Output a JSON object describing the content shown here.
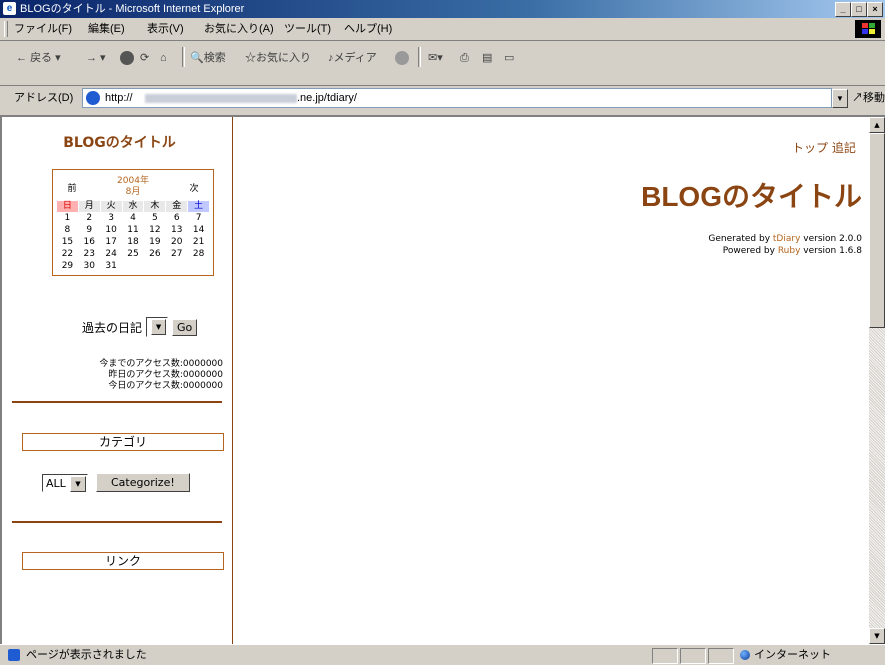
{
  "window": {
    "title": "BLOGのタイトル - Microsoft Internet Explorer",
    "controls": [
      "_",
      "□",
      "×"
    ]
  },
  "menu": [
    "ファイル(F)",
    "編集(E)",
    "表示(V)",
    "お気に入り(A)",
    "ツール(T)",
    "ヘルプ(H)"
  ],
  "toolbar": {
    "back": "戻る",
    "search": "検索",
    "favorites": "お気に入り",
    "media": "メディア"
  },
  "address": {
    "label": "アドレス(D)",
    "url_prefix": "http://",
    "url_suffix": ".ne.jp/tdiary/",
    "go": "移動"
  },
  "sidebar": {
    "title": "BLOGのタイトル",
    "calendar": {
      "prev": "前",
      "next": "次",
      "year": "2004年",
      "month": "8月",
      "weekdays": [
        "日",
        "月",
        "火",
        "水",
        "木",
        "金",
        "土"
      ],
      "days": [
        "1",
        "2",
        "3",
        "4",
        "5",
        "6",
        "7",
        "8",
        "9",
        "10",
        "11",
        "12",
        "13",
        "14",
        "15",
        "16",
        "17",
        "18",
        "19",
        "20",
        "21",
        "22",
        "23",
        "24",
        "25",
        "26",
        "27",
        "28",
        "29",
        "30",
        "31"
      ]
    },
    "past_diary_label": "過去の日記",
    "go_button": "Go",
    "access": {
      "total": "今までのアクセス数:0000000",
      "yesterday": "昨日のアクセス数:0000000",
      "today": "今日のアクセス数:0000000"
    },
    "category_heading": "カテゴリ",
    "category_select": "ALL",
    "categorize_button": "Categorize!",
    "links_heading": "リンク"
  },
  "main": {
    "nav_top": "トップ",
    "nav_append": "追記",
    "title": "BLOGのタイトル",
    "generated_prefix": "Generated by ",
    "generated_link": "tDiary",
    "generated_suffix": " version 2.0.0",
    "powered_prefix": "Powered by ",
    "powered_link": "Ruby",
    "powered_suffix": " version 1.6.8"
  },
  "status": {
    "text": "ページが表示されました",
    "zone": "インターネット"
  },
  "colors": {
    "accent": "#8b4513",
    "calendar_border": "#b5651d",
    "sunday": "#ffb0b0",
    "saturday": "#c0c8ff"
  }
}
